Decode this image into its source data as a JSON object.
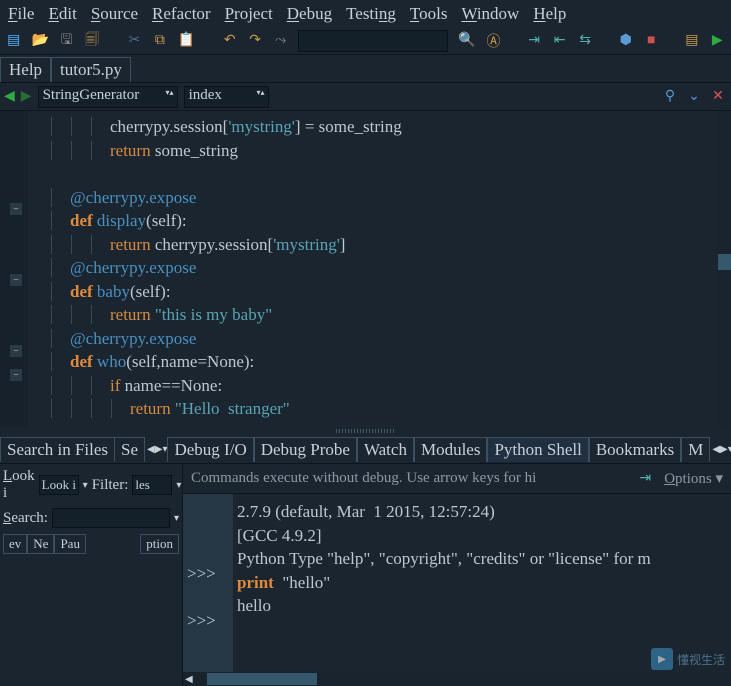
{
  "menu": {
    "file": "File",
    "edit": "Edit",
    "source": "Source",
    "refactor": "Refactor",
    "project": "Project",
    "debug": "Debug",
    "testing": "Testing",
    "tools": "Tools",
    "window": "Window",
    "help": "Help"
  },
  "tabs": {
    "help": "Help",
    "file": "tutor5.py"
  },
  "nav": {
    "class": "StringGenerator",
    "method": "index"
  },
  "code_lines": [
    {
      "indent": 3,
      "segs": [
        {
          "t": "cherrypy.session["
        },
        {
          "t": "'mystring'",
          "c": "str"
        },
        {
          "t": "] = some_string"
        }
      ]
    },
    {
      "indent": 3,
      "segs": [
        {
          "t": "return",
          "c": "kw2"
        },
        {
          "t": " some_string"
        }
      ]
    },
    {
      "indent": 0,
      "segs": [
        {
          "t": ""
        }
      ]
    },
    {
      "indent": 1,
      "segs": [
        {
          "t": "@cherrypy.expose",
          "c": "dec"
        }
      ]
    },
    {
      "indent": 1,
      "segs": [
        {
          "t": "def",
          "c": "kw"
        },
        {
          "t": " "
        },
        {
          "t": "display",
          "c": "fn"
        },
        {
          "t": "(self):"
        }
      ]
    },
    {
      "indent": 3,
      "segs": [
        {
          "t": "return",
          "c": "kw2"
        },
        {
          "t": " cherrypy.session["
        },
        {
          "t": "'mystring'",
          "c": "str"
        },
        {
          "t": "]"
        }
      ]
    },
    {
      "indent": 1,
      "segs": [
        {
          "t": "@cherrypy.expose",
          "c": "dec"
        }
      ]
    },
    {
      "indent": 1,
      "segs": [
        {
          "t": "def",
          "c": "kw"
        },
        {
          "t": " "
        },
        {
          "t": "baby",
          "c": "fn"
        },
        {
          "t": "(self):"
        }
      ]
    },
    {
      "indent": 3,
      "segs": [
        {
          "t": "return",
          "c": "kw2"
        },
        {
          "t": " "
        },
        {
          "t": "\"this is my baby\"",
          "c": "str"
        }
      ]
    },
    {
      "indent": 1,
      "segs": [
        {
          "t": "@cherrypy.expose",
          "c": "dec"
        }
      ]
    },
    {
      "indent": 1,
      "segs": [
        {
          "t": "def",
          "c": "kw"
        },
        {
          "t": " "
        },
        {
          "t": "who",
          "c": "fn"
        },
        {
          "t": "(self,name=None):"
        }
      ]
    },
    {
      "indent": 3,
      "segs": [
        {
          "t": "if",
          "c": "kw2"
        },
        {
          "t": " name==None:"
        }
      ]
    },
    {
      "indent": 4,
      "segs": [
        {
          "t": "return",
          "c": "kw2"
        },
        {
          "t": " "
        },
        {
          "t": "\"Hello  stranger\"",
          "c": "str"
        }
      ]
    }
  ],
  "search_panel": {
    "lookin_label": "Look iles",
    "lookin_val": "",
    "filter_label": "Filter:",
    "filter_val": "les",
    "search_label": "Search:",
    "search_val": "",
    "btn_prev": "ev",
    "btn_next": "Ne",
    "btn_pause": "Pau",
    "btn_options": "ption"
  },
  "bottom_tabs": {
    "search_files": "Search in Files",
    "search": "Se",
    "debugio": "Debug I/O",
    "debugprobe": "Debug Probe",
    "watch": "Watch",
    "modules": "Modules",
    "pyshell": "Python Shell",
    "bookmarks": "Bookmarks",
    "more": "M"
  },
  "shell": {
    "hint": "Commands execute without debug.  Use arrow keys for hi",
    "options": "Options",
    "lines": [
      "2.7.9 (default, Mar  1 2015, 12:57:24)",
      "[GCC 4.9.2]",
      "Python Type \"help\", \"copyright\", \"credits\" or \"license\" for m",
      {
        "pre": "print",
        "c": "kw",
        "post": "  \"hello\""
      },
      "hello"
    ],
    "prompt": ">>>"
  },
  "watermark": "懂视生活"
}
